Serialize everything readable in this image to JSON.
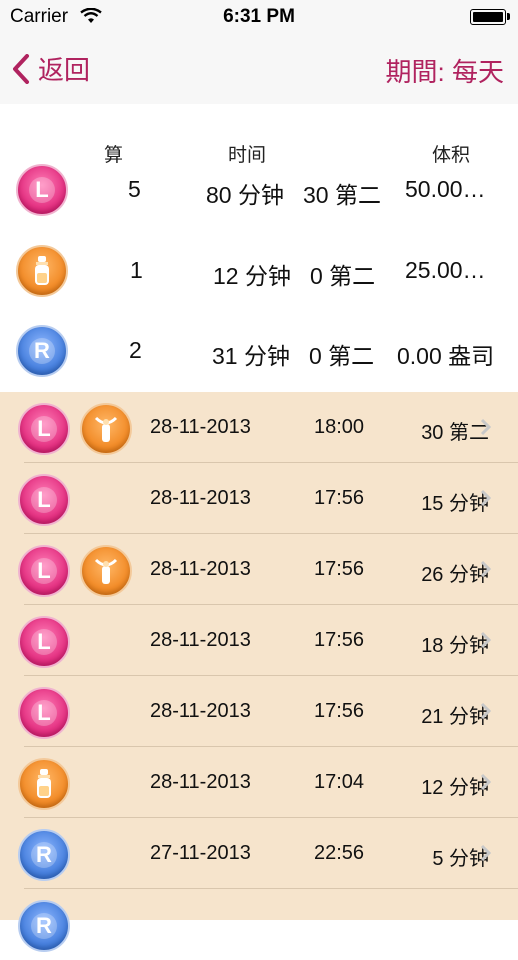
{
  "status": {
    "carrier": "Carrier",
    "time": "6:31 PM"
  },
  "nav": {
    "back_label": "返回",
    "period_label": "期間: 每天"
  },
  "colors": {
    "accent": "#b0235f",
    "list_bg": "#f6e4cc"
  },
  "summary": {
    "headers": {
      "count": "算",
      "time": "时间",
      "volume": "体积"
    },
    "rows": [
      {
        "icon": "left-breast-icon",
        "count": "5",
        "minutes": "80 分钟",
        "seconds": "30 第二",
        "volume": "50.00…"
      },
      {
        "icon": "bottle-icon",
        "count": "1",
        "minutes": "12 分钟",
        "seconds": "0 第二",
        "volume": "25.00…"
      },
      {
        "icon": "right-breast-icon",
        "count": "2",
        "minutes": "31 分钟",
        "seconds": "0 第二",
        "volume": "0.00 盎司"
      }
    ]
  },
  "entries": [
    {
      "icon1": "left-breast-icon",
      "icon2": "breast-pump-icon",
      "date": "28-11-2013",
      "time": "18:00",
      "duration": "30 第二"
    },
    {
      "icon1": "left-breast-icon",
      "icon2": "",
      "date": "28-11-2013",
      "time": "17:56",
      "duration": "15 分钟"
    },
    {
      "icon1": "left-breast-icon",
      "icon2": "breast-pump-icon",
      "date": "28-11-2013",
      "time": "17:56",
      "duration": "26 分钟"
    },
    {
      "icon1": "left-breast-icon",
      "icon2": "",
      "date": "28-11-2013",
      "time": "17:56",
      "duration": "18 分钟"
    },
    {
      "icon1": "left-breast-icon",
      "icon2": "",
      "date": "28-11-2013",
      "time": "17:56",
      "duration": "21 分钟"
    },
    {
      "icon1": "bottle-icon",
      "icon2": "",
      "date": "28-11-2013",
      "time": "17:04",
      "duration": "12 分钟"
    },
    {
      "icon1": "right-breast-icon",
      "icon2": "",
      "date": "27-11-2013",
      "time": "22:56",
      "duration": "5 分钟"
    },
    {
      "icon1": "right-breast-icon",
      "icon2": "",
      "date": "",
      "time": "",
      "duration": ""
    }
  ]
}
